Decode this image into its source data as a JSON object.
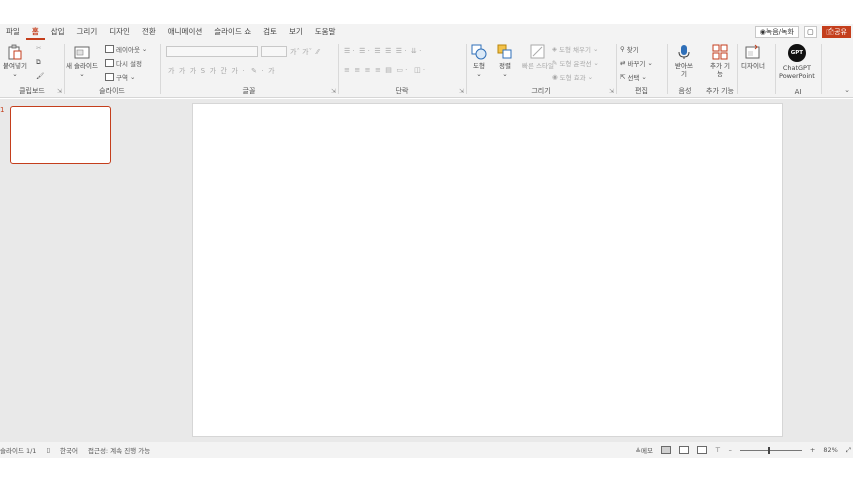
{
  "menu": {
    "items": [
      "파일",
      "홈",
      "삽입",
      "그리기",
      "디자인",
      "전환",
      "애니메이션",
      "슬라이드 쇼",
      "검토",
      "보기",
      "도움말"
    ],
    "active_index": 1,
    "record_label": "◉녹음/녹화",
    "share_label": "🖆공유"
  },
  "ribbon": {
    "clipboard": {
      "label": "클립보드",
      "paste_label": "붙여넣기"
    },
    "slides": {
      "label": "슬라이드",
      "new_slide_label": "새 슬라이드",
      "layout_label": "레이아웃",
      "reset_label": "다시 설정",
      "section_label": "구역"
    },
    "font": {
      "label": "글꼴"
    },
    "paragraph": {
      "label": "단락"
    },
    "drawing": {
      "label": "그리기",
      "shapes_label": "도형",
      "arrange_label": "정렬",
      "quick_styles_label": "빠른 스타일",
      "fill_label": "도형 채우기",
      "outline_label": "도형 윤곽선",
      "effects_label": "도형 효과"
    },
    "editing": {
      "label": "편집",
      "find_label": "찾기",
      "replace_label": "바꾸기",
      "select_label": "선택"
    },
    "voice": {
      "label": "음성",
      "dictate_label": "받아쓰기"
    },
    "addins": {
      "label": "추가 기능",
      "addins_label": "추가 기능"
    },
    "designer": {
      "label": "디자이너"
    },
    "ai": {
      "label": "AI",
      "gpt_badge": "GPT",
      "chatgpt_line1": "ChatGPT",
      "chatgpt_line2": "PowerPoint"
    }
  },
  "slides_pane": {
    "slide_number": "1"
  },
  "status": {
    "slide_count": "슬라이드 1/1",
    "language": "한국어",
    "accessibility": "접근성: 계속 진행 가능",
    "notes_label": "≜메모",
    "zoom": "82%"
  }
}
